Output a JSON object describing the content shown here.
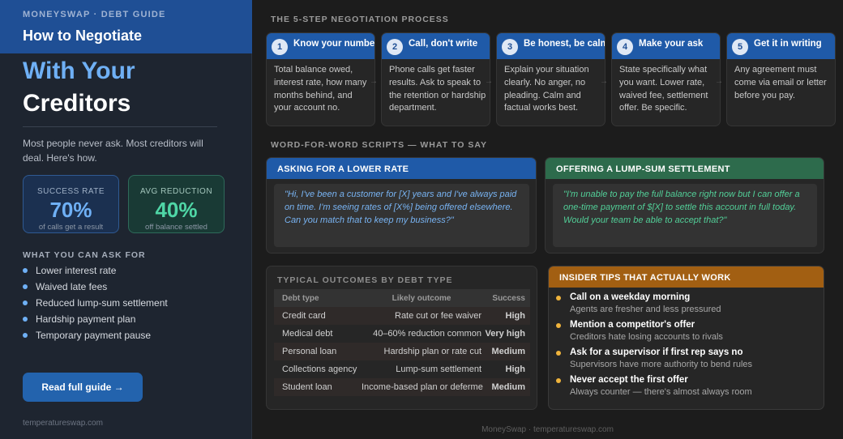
{
  "sidebar": {
    "kicker": "MONEYSWAP · DEBT GUIDE",
    "title": "How to Negotiate",
    "hero_line1": "With Your",
    "hero_line2": "Creditors",
    "lede": "Most people never ask. Most creditors will deal. Here's how.",
    "stats": [
      {
        "label": "SUCCESS RATE",
        "value": "70%",
        "sub": "of calls get a result",
        "color": "#6fb0f5"
      },
      {
        "label": "AVG REDUCTION",
        "value": "40%",
        "sub": "off balance settled",
        "color": "#4fd6a6"
      }
    ],
    "ask_heading": "WHAT YOU CAN ASK FOR",
    "ask_items": [
      "Lower interest rate",
      "Waived late fees",
      "Reduced lump-sum settlement",
      "Hardship payment plan",
      "Temporary payment pause"
    ],
    "cta_label": "Read full guide →",
    "footer": "temperatureswap.com"
  },
  "process": {
    "heading": "THE 5-STEP NEGOTIATION PROCESS",
    "steps": [
      {
        "num": "1",
        "title": "Know your numbers",
        "body": "Total balance owed, interest rate, how many months behind, and your account no."
      },
      {
        "num": "2",
        "title": "Call, don't write",
        "body": "Phone calls get faster results. Ask to speak to the retention or hardship department."
      },
      {
        "num": "3",
        "title": "Be honest, be calm",
        "body": "Explain your situation clearly. No anger, no pleading. Calm and factual works best."
      },
      {
        "num": "4",
        "title": "Make your ask",
        "body": "State specifically what you want. Lower rate, waived fee, settlement offer. Be specific."
      },
      {
        "num": "5",
        "title": "Get it in writing",
        "body": "Any agreement must come via email or letter before you pay."
      }
    ],
    "arrow": "→"
  },
  "scripts": {
    "heading": "WORD-FOR-WORD SCRIPTS — WHAT TO SAY",
    "lower_rate": {
      "title": "ASKING FOR A LOWER RATE",
      "quote": "\"Hi, I've been a customer for [X] years and I've always paid on time. I'm seeing rates of [X%] being offered elsewhere. Can you match that to keep my business?\""
    },
    "settlement": {
      "title": "OFFERING A LUMP-SUM SETTLEMENT",
      "quote": "\"I'm unable to pay the full balance right now but I can offer a one-time payment of $[X] to settle this account in full today. Would your team be able to accept that?\""
    }
  },
  "outcomes": {
    "heading": "TYPICAL OUTCOMES BY DEBT TYPE",
    "columns": [
      "Debt type",
      "Likely outcome",
      "Success"
    ],
    "rows": [
      {
        "type": "Credit card",
        "outcome": "Rate cut or fee waiver",
        "success": "High",
        "level": "high"
      },
      {
        "type": "Medical debt",
        "outcome": "40–60% reduction common",
        "success": "Very high",
        "level": "high"
      },
      {
        "type": "Personal loan",
        "outcome": "Hardship plan or rate cut",
        "success": "Medium",
        "level": "med"
      },
      {
        "type": "Collections agency",
        "outcome": "Lump-sum settlement",
        "success": "High",
        "level": "high"
      },
      {
        "type": "Student loan",
        "outcome": "Income-based plan or deferment",
        "success": "Medium",
        "level": "med"
      }
    ],
    "colors": {
      "high": "#52cf98",
      "medium": "#f0b43c"
    }
  },
  "tips": {
    "heading": "INSIDER TIPS THAT ACTUALLY WORK",
    "items": [
      {
        "title": "Call on a weekday morning",
        "sub": "Agents are fresher and less pressured"
      },
      {
        "title": "Mention a competitor's offer",
        "sub": "Creditors hate losing accounts to rivals"
      },
      {
        "title": "Ask for a supervisor if first rep says no",
        "sub": "Supervisors have more authority to bend rules"
      },
      {
        "title": "Never accept the first offer",
        "sub": "Always counter — there's almost always room"
      }
    ]
  },
  "footer": "MoneySwap · temperatureswap.com"
}
